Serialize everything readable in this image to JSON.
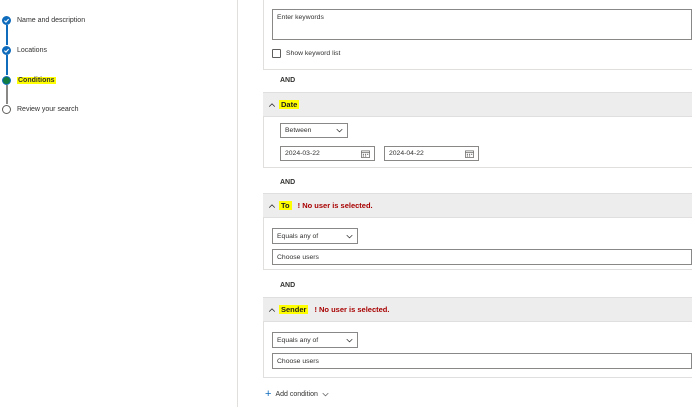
{
  "wizard": {
    "steps": [
      {
        "label": "Name and description",
        "state": "done"
      },
      {
        "label": "Locations",
        "state": "done"
      },
      {
        "label": "Conditions",
        "state": "current"
      },
      {
        "label": "Review your search",
        "state": "todo"
      }
    ]
  },
  "keywords": {
    "placeholder": "Enter keywords",
    "show_list_label": "Show keyword list"
  },
  "operators": {
    "and1": "AND",
    "and2": "AND",
    "and3": "AND"
  },
  "date_section": {
    "title": "Date",
    "operator": "Between",
    "start": "2024-03-22",
    "end": "2024-04-22"
  },
  "to_section": {
    "title": "To",
    "error": "! No user is selected.",
    "operator": "Equals any of",
    "placeholder": "Choose users"
  },
  "sender_section": {
    "title": "Sender",
    "error": "! No user is selected.",
    "operator": "Equals any of",
    "placeholder": "Choose users"
  },
  "footer": {
    "add_condition_label": "Add condition"
  },
  "colors": {
    "accent": "#0f6cbd",
    "error": "#a80000",
    "highlight": "#ffff00",
    "current_step": "#107c41"
  },
  "icons": [
    "check-icon",
    "chevron-up-icon",
    "chevron-down-icon",
    "calendar-icon",
    "plus-icon"
  ]
}
